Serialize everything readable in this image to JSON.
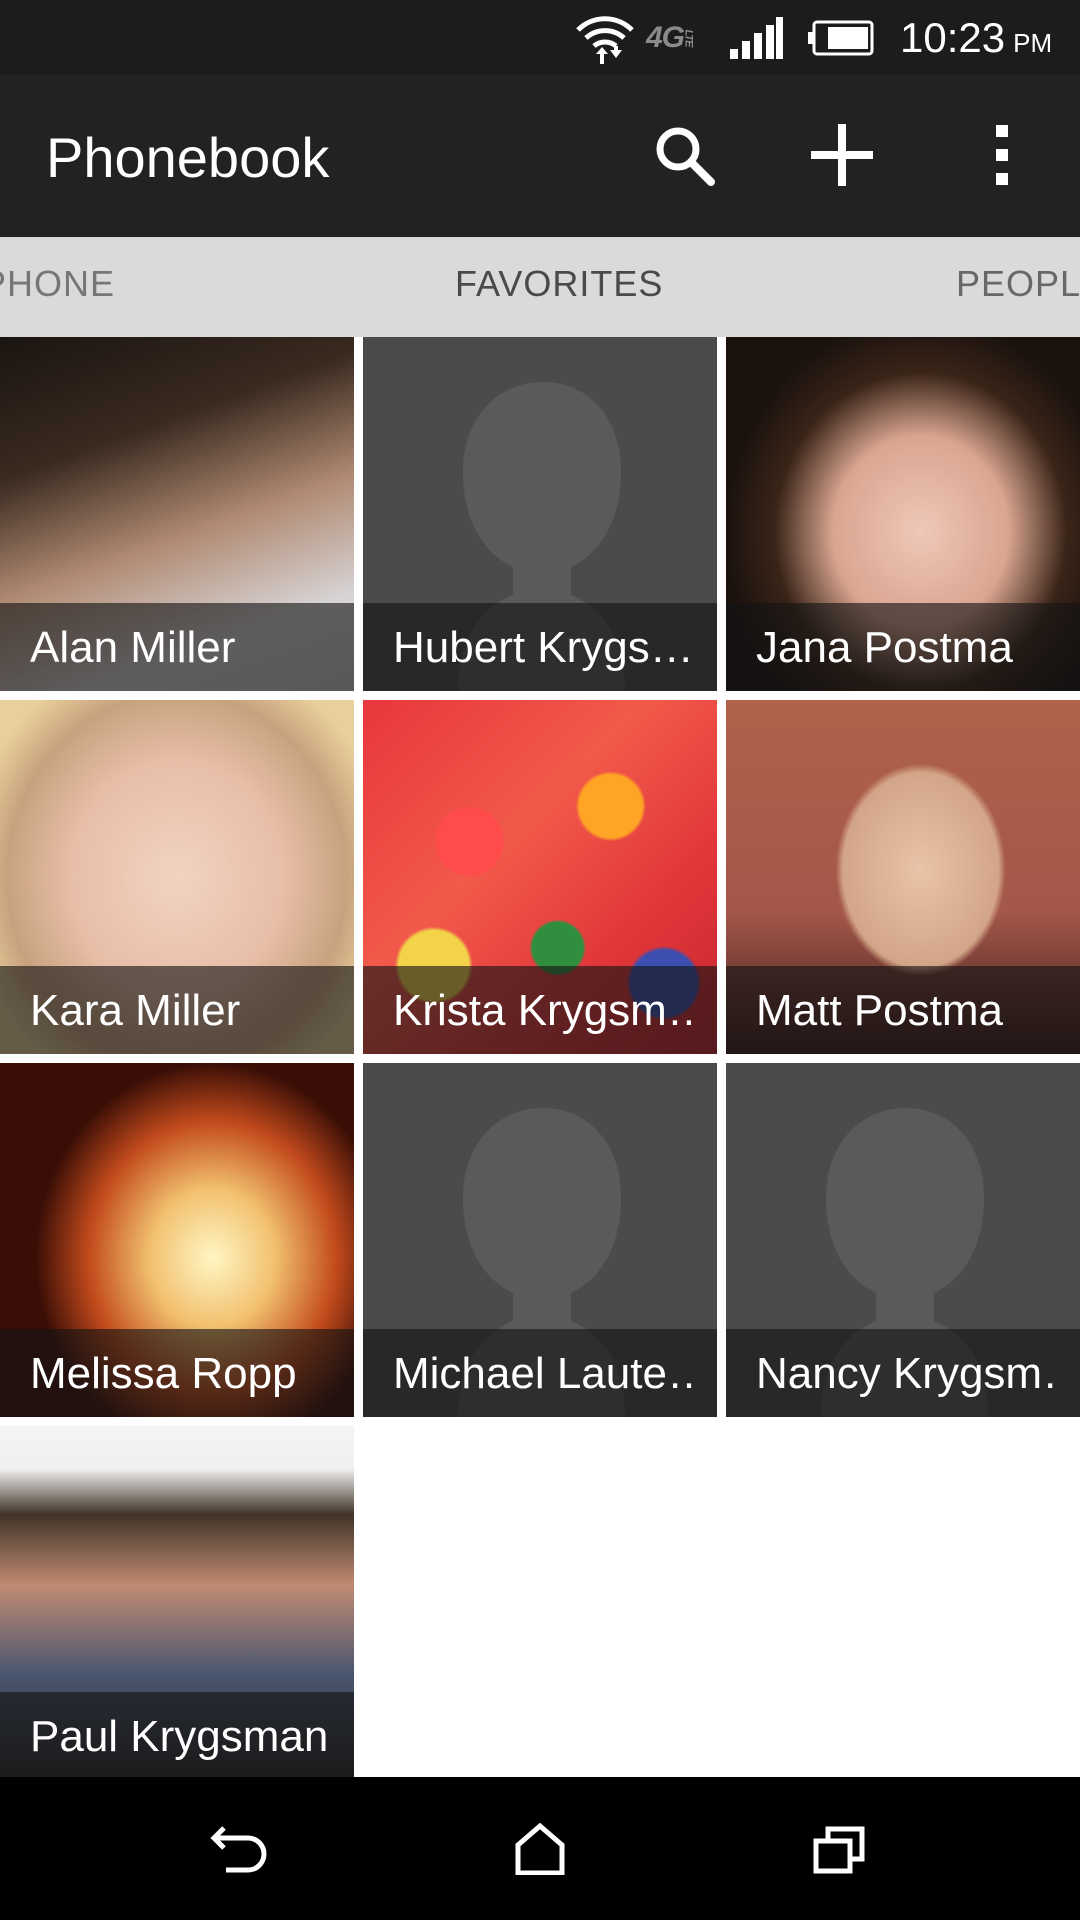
{
  "status_bar": {
    "time": "10:23",
    "ampm": "PM",
    "network": "4G",
    "network_sub": "LTE",
    "icons": [
      "wifi-icon",
      "signal-icon",
      "battery-icon"
    ]
  },
  "action_bar": {
    "title": "Phonebook",
    "actions": [
      "search-icon",
      "add-icon",
      "overflow-menu-icon"
    ]
  },
  "tabs": [
    {
      "label": "PHONE",
      "state": "partial-left"
    },
    {
      "label": "FAVORITES",
      "state": "selected"
    },
    {
      "label": "PEOPLE",
      "state": "partial-right"
    }
  ],
  "favorites": [
    {
      "name": "Alan Miller",
      "photo": "photo"
    },
    {
      "name": "Hubert Krygs…",
      "photo": "placeholder"
    },
    {
      "name": "Jana Postma",
      "photo": "photo"
    },
    {
      "name": "Kara Miller",
      "photo": "photo"
    },
    {
      "name": "Krista Krygsm…",
      "photo": "photo"
    },
    {
      "name": "Matt Postma",
      "photo": "photo"
    },
    {
      "name": "Melissa Ropp",
      "photo": "photo"
    },
    {
      "name": "Michael Laute…",
      "photo": "placeholder"
    },
    {
      "name": "Nancy Krygsm…",
      "photo": "placeholder"
    },
    {
      "name": "Paul Krygsman",
      "photo": "photo"
    }
  ],
  "nav_bar": {
    "buttons": [
      "back-icon",
      "home-icon",
      "recent-apps-icon"
    ]
  },
  "colors": {
    "status_bar": "#1c1c1c",
    "action_bar": "#222222",
    "tab_strip": "#dadada",
    "placeholder_tile": "#4b4b4b",
    "nav_bar": "#000000"
  }
}
